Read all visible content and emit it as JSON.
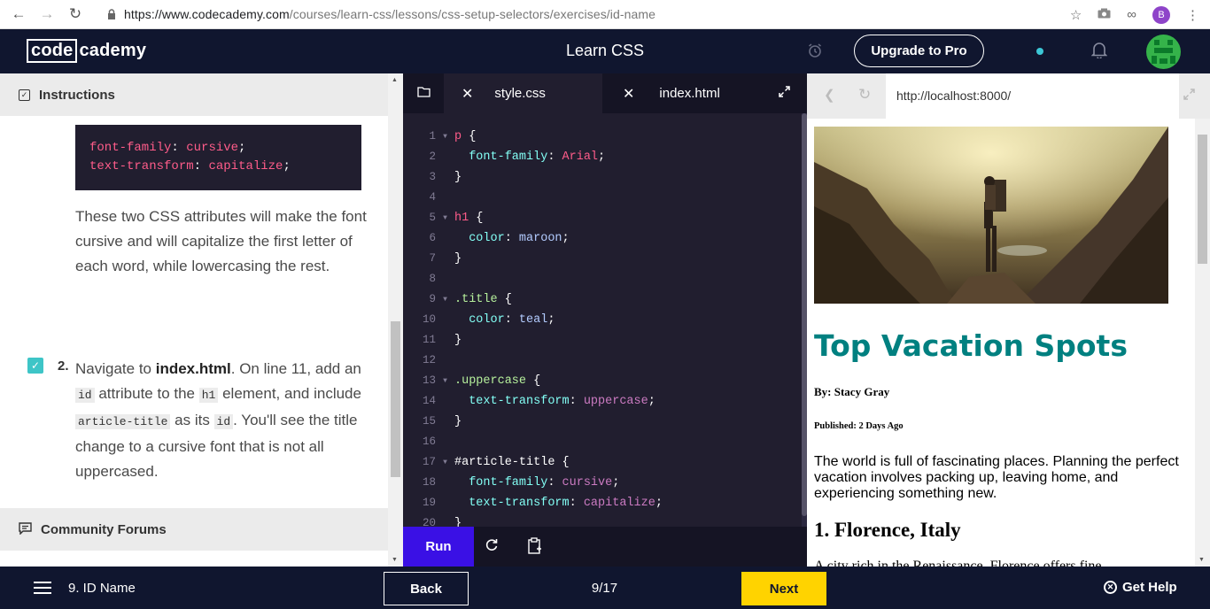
{
  "browser": {
    "url_host": "https://www.codecademy.com",
    "url_path": "/courses/learn-css/lessons/css-setup-selectors/exercises/id-name",
    "profile_letter": "B"
  },
  "header": {
    "logo_box": "code",
    "logo_rest": "cademy",
    "title": "Learn CSS",
    "upgrade_label": "Upgrade to Pro"
  },
  "instructions": {
    "heading": "Instructions",
    "code_lines": [
      {
        "prop": "font-family",
        "val": "cursive"
      },
      {
        "prop": "text-transform",
        "val": "capitalize"
      }
    ],
    "paragraph": "These two CSS attributes will make the font cursive and will capitalize the first letter of each word, while lowercasing the rest.",
    "task_number": "2.",
    "task": {
      "t1": "Navigate to ",
      "b1": "index.html",
      "t2": ". On line 11, add an ",
      "c1": "id",
      "t3": " attribute to the ",
      "c2": "h1",
      "t4": " element, and include ",
      "c3": "article-title",
      "t5": " as its ",
      "c4": "id",
      "t6": ". You'll see the title change to a cursive font that is not all uppercased."
    },
    "forum_heading": "Community Forums"
  },
  "editor": {
    "tab_active": "style.css",
    "tab_other": "index.html",
    "run_label": "Run",
    "lines": [
      {
        "n": "1",
        "fold": true,
        "parts": [
          [
            "sel-tag",
            "p"
          ],
          [
            "punc",
            " {"
          ]
        ]
      },
      {
        "n": "2",
        "fold": false,
        "parts": [
          [
            "punc",
            "  "
          ],
          [
            "prop",
            "font-family"
          ],
          [
            "punc",
            ": "
          ],
          [
            "val",
            "Arial"
          ],
          [
            "punc",
            ";"
          ]
        ]
      },
      {
        "n": "3",
        "fold": false,
        "parts": [
          [
            "punc",
            "}"
          ]
        ]
      },
      {
        "n": "4",
        "fold": false,
        "parts": []
      },
      {
        "n": "5",
        "fold": true,
        "parts": [
          [
            "sel-tag",
            "h1"
          ],
          [
            "punc",
            " {"
          ]
        ]
      },
      {
        "n": "6",
        "fold": false,
        "parts": [
          [
            "punc",
            "  "
          ],
          [
            "prop",
            "color"
          ],
          [
            "punc",
            ": "
          ],
          [
            "val2",
            "maroon"
          ],
          [
            "punc",
            ";"
          ]
        ]
      },
      {
        "n": "7",
        "fold": false,
        "parts": [
          [
            "punc",
            "}"
          ]
        ]
      },
      {
        "n": "8",
        "fold": false,
        "parts": []
      },
      {
        "n": "9",
        "fold": true,
        "parts": [
          [
            "sel-cls",
            ".title"
          ],
          [
            "punc",
            " {"
          ]
        ]
      },
      {
        "n": "10",
        "fold": false,
        "parts": [
          [
            "punc",
            "  "
          ],
          [
            "prop",
            "color"
          ],
          [
            "punc",
            ": "
          ],
          [
            "val2",
            "teal"
          ],
          [
            "punc",
            ";"
          ]
        ]
      },
      {
        "n": "11",
        "fold": false,
        "parts": [
          [
            "punc",
            "}"
          ]
        ]
      },
      {
        "n": "12",
        "fold": false,
        "parts": []
      },
      {
        "n": "13",
        "fold": true,
        "parts": [
          [
            "sel-cls",
            ".uppercase"
          ],
          [
            "punc",
            " {"
          ]
        ]
      },
      {
        "n": "14",
        "fold": false,
        "parts": [
          [
            "punc",
            "  "
          ],
          [
            "prop",
            "text-transform"
          ],
          [
            "punc",
            ": "
          ],
          [
            "val3",
            "uppercase"
          ],
          [
            "punc",
            ";"
          ]
        ]
      },
      {
        "n": "15",
        "fold": false,
        "parts": [
          [
            "punc",
            "}"
          ]
        ]
      },
      {
        "n": "16",
        "fold": false,
        "parts": []
      },
      {
        "n": "17",
        "fold": true,
        "parts": [
          [
            "sel-id",
            "#article-title"
          ],
          [
            "punc",
            " {"
          ]
        ]
      },
      {
        "n": "18",
        "fold": false,
        "parts": [
          [
            "punc",
            "  "
          ],
          [
            "prop",
            "font-family"
          ],
          [
            "punc",
            ": "
          ],
          [
            "val3",
            "cursive"
          ],
          [
            "punc",
            ";"
          ]
        ]
      },
      {
        "n": "19",
        "fold": false,
        "parts": [
          [
            "punc",
            "  "
          ],
          [
            "prop",
            "text-transform"
          ],
          [
            "punc",
            ": "
          ],
          [
            "val3",
            "capitalize"
          ],
          [
            "punc",
            ";"
          ]
        ]
      },
      {
        "n": "20",
        "fold": false,
        "parts": [
          [
            "punc",
            "}"
          ]
        ]
      }
    ]
  },
  "preview": {
    "address": "http://localhost:8000/",
    "title": "Top Vacation Spots",
    "byline": "By: Stacy Gray",
    "published": "Published: 2 Days Ago",
    "intro": "The world is full of fascinating places. Planning the perfect vacation involves packing up, leaving home, and experiencing something new.",
    "h2": "1. Florence, Italy",
    "cut_text": "A city rich in the Renaissance, Florence offers fine"
  },
  "footer": {
    "exercise": "9. ID Name",
    "back_label": "Back",
    "progress": "9/17",
    "next_label": "Next",
    "help_label": "Get Help"
  },
  "colors": {
    "header_bg": "#10162f",
    "run_bg": "#3a10e5",
    "next_bg": "#ffd300",
    "check_bg": "#3ec5c7",
    "title_color": "#008080"
  }
}
